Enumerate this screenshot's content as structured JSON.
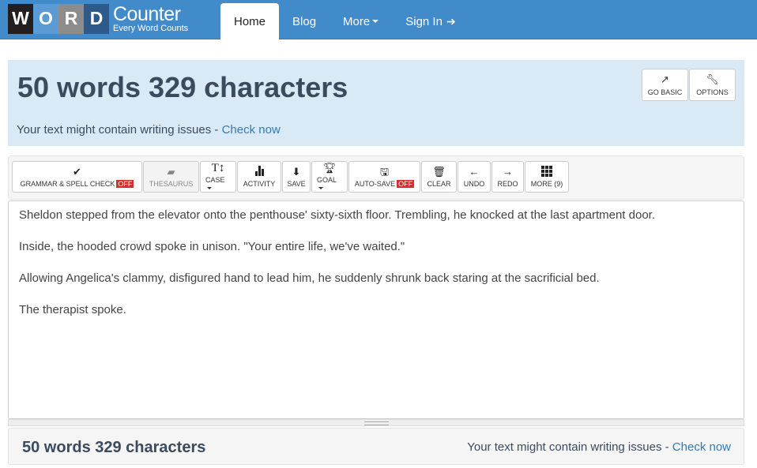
{
  "brand": {
    "tiles": [
      "W",
      "O",
      "R",
      "D"
    ],
    "name": "Counter",
    "tagline": "Every Word Counts"
  },
  "nav": {
    "items": [
      {
        "label": "Home",
        "active": true
      },
      {
        "label": "Blog"
      },
      {
        "label": "More"
      },
      {
        "label": "Sign In"
      }
    ]
  },
  "summary": {
    "count_text": "50 words 329 characters",
    "issue_text": "Your text might contain writing issues - ",
    "issue_link": "Check now"
  },
  "header_buttons": {
    "go_basic": "GO BASIC",
    "options": "OPTIONS"
  },
  "toolbar": {
    "grammar": "GRAMMAR & SPELL CHECK",
    "grammar_state": "OFF",
    "thesaurus": "THESAURUS",
    "case": "CASE",
    "activity": "ACTIVITY",
    "save": "SAVE",
    "goal": "GOAL",
    "autosave": "AUTO-SAVE",
    "autosave_state": "OFF",
    "clear": "CLEAR",
    "undo": "UNDO",
    "redo": "REDO",
    "more": "MORE (9)"
  },
  "editor": {
    "paragraphs": [
      "Sheldon stepped from the elevator onto the penthouse' sixty-sixth floor. Trembling, he knocked at the last apartment door.",
      "Inside, the hooded crowd spoke in unison. \"Your entire life, we've waited.\"",
      "Allowing Angelica's clammy, disfigured hand to lead him, he suddenly shrunk back staring at the sacrificial bed.",
      "The therapist spoke."
    ]
  },
  "footer": {
    "count_text": "50 words 329 characters",
    "issue_text": "Your text might contain writing issues - ",
    "issue_link": "Check now"
  },
  "colors": {
    "navbar": "#428bca",
    "panel": "#d9eaf6",
    "link": "#337ab7",
    "off_badge": "#d12f2f"
  }
}
